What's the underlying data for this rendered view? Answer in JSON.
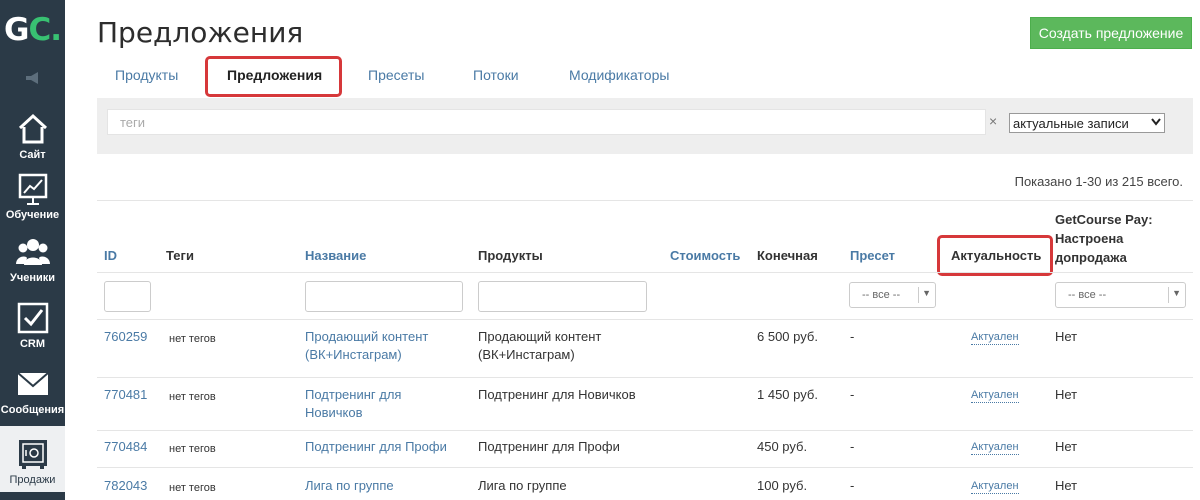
{
  "sidebar": {
    "logo": {
      "g": "G",
      "c": "C",
      "dot": "."
    },
    "items": [
      {
        "label": "Сайт",
        "icon": "home-icon"
      },
      {
        "label": "Обучение",
        "icon": "chart-board-icon"
      },
      {
        "label": "Ученики",
        "icon": "users-icon"
      },
      {
        "label": "CRM",
        "icon": "checkbox-icon"
      },
      {
        "label": "Сообщения",
        "icon": "envelope-icon"
      },
      {
        "label": "Продажи",
        "icon": "safe-icon"
      }
    ]
  },
  "header": {
    "title": "Предложения",
    "create_button": "Создать предложение"
  },
  "tabs": [
    {
      "label": "Продукты"
    },
    {
      "label": "Предложения",
      "active": true
    },
    {
      "label": "Пресеты"
    },
    {
      "label": "Потоки"
    },
    {
      "label": "Модификаторы"
    }
  ],
  "filters": {
    "tags_placeholder": "теги",
    "clear": "×",
    "status_selected": "актуальные записи",
    "id_filter_value": "",
    "name_filter_value": "",
    "products_filter_value": "",
    "preset_filter": "-- все --",
    "pay_filter": "-- все --"
  },
  "summary": "Показано 1-30 из 215 всего.",
  "table": {
    "columns": {
      "id": "ID",
      "tags": "Теги",
      "name": "Название",
      "products": "Продукты",
      "cost": "Стоимость",
      "final": "Конечная",
      "preset": "Пресет",
      "actual": "Актуальность",
      "pay_line1": "GetCourse Pay:",
      "pay_line2": "Настроена",
      "pay_line3": "допродажа"
    },
    "rows": [
      {
        "id": "760259",
        "tags": "нет тегов",
        "name_l1": "Продающий контент",
        "name_l2": "(ВК+Инстаграм)",
        "products_l1": "Продающий контент",
        "products_l2": "(ВК+Инстаграм)",
        "final": "6 500 руб.",
        "preset": "-",
        "actual": "Актуален",
        "pay": "Нет"
      },
      {
        "id": "770481",
        "tags": "нет тегов",
        "name_l1": "Подтренинг для",
        "name_l2": "Новичков",
        "products_l1": "Подтренинг для Новичков",
        "products_l2": "",
        "final": "1 450 руб.",
        "preset": "-",
        "actual": "Актуален",
        "pay": "Нет"
      },
      {
        "id": "770484",
        "tags": "нет тегов",
        "name_l1": "Подтренинг для Профи",
        "name_l2": "",
        "products_l1": "Подтренинг для Профи",
        "products_l2": "",
        "final": "450 руб.",
        "preset": "-",
        "actual": "Актуален",
        "pay": "Нет"
      },
      {
        "id": "782043",
        "tags": "нет тегов",
        "name_l1": "Лига по группе",
        "name_l2": "",
        "products_l1": "Лига по группе",
        "products_l2": "",
        "final": "100 руб.",
        "preset": "-",
        "actual": "Актуален",
        "pay": "Нет"
      }
    ]
  },
  "colors": {
    "sidebar_bg": "#2b3a47",
    "logo_accent": "#38c172",
    "link": "#4a7aa5",
    "button_green": "#5cb85c",
    "highlight_red": "#d6383a"
  }
}
